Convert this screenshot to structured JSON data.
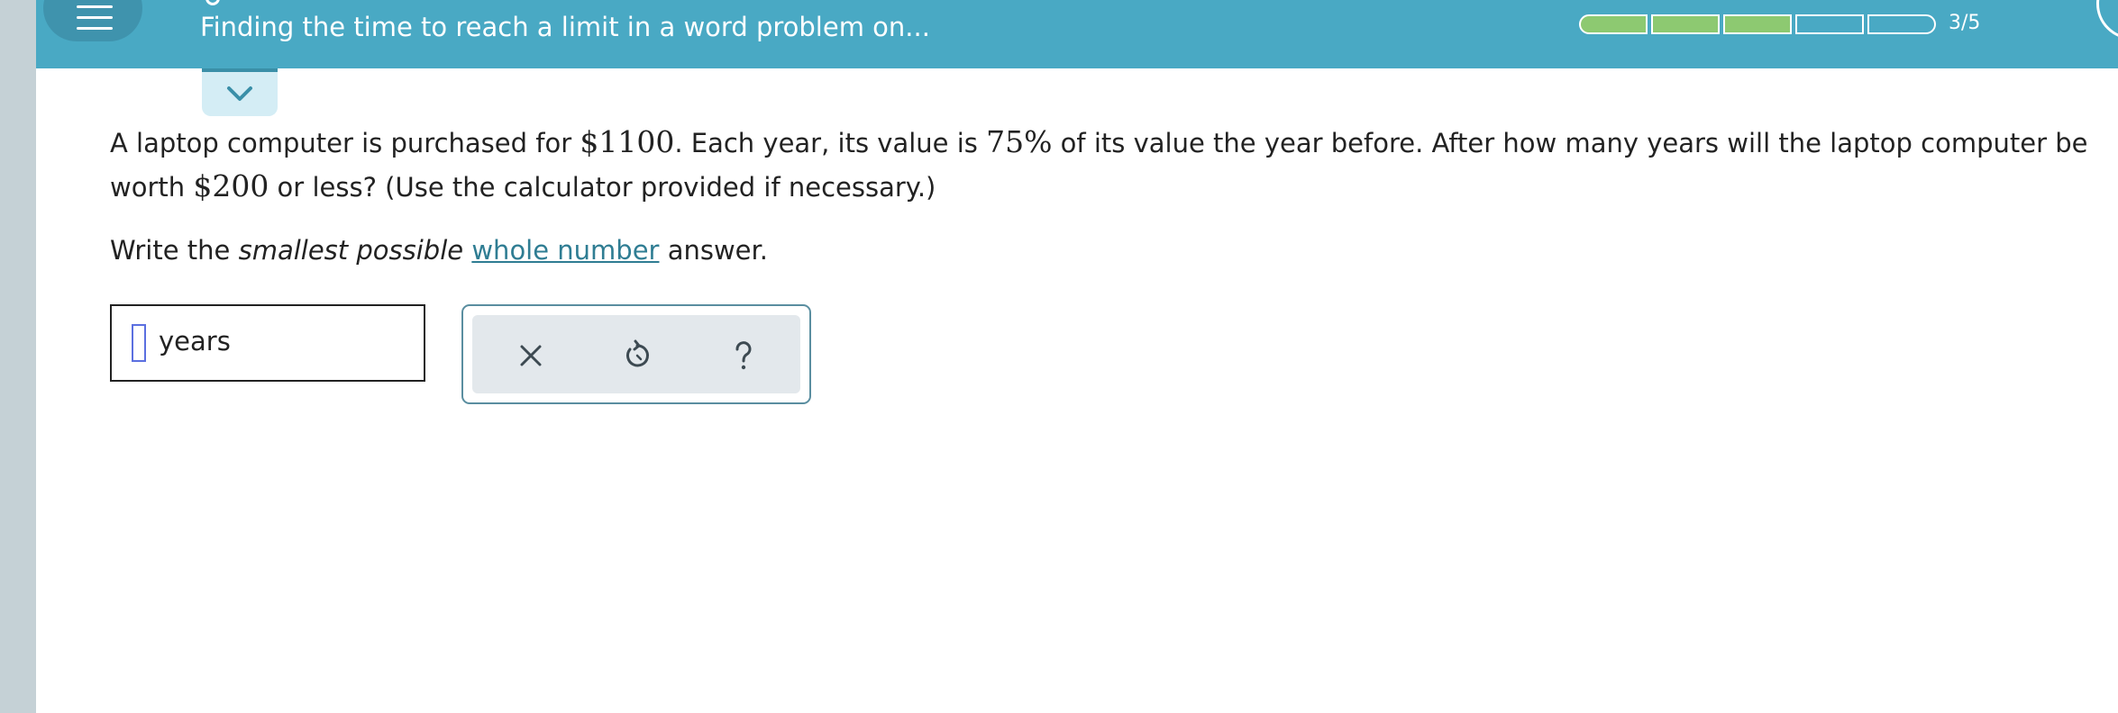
{
  "header": {
    "menu_icon": "hamburger-menu-icon",
    "topic_title": "Finding the time to reach a limit in a word problem on...",
    "progress": {
      "completed": 3,
      "total": 5,
      "label": "3/5"
    }
  },
  "problem": {
    "part1": "A laptop computer is purchased for ",
    "price": "$1100",
    "part2": ". Each year, its value is ",
    "percent": "75%",
    "part3": " of its value the year before. After how many years will the laptop computer be worth ",
    "target": "$200",
    "part4": " or less? (Use the calculator provided if necessary.)"
  },
  "instruction": {
    "before": "Write the ",
    "emphasis": "smallest possible",
    "space": " ",
    "link_text": "whole number",
    "after": " answer."
  },
  "answer": {
    "value": "",
    "unit": "years"
  },
  "tools": {
    "clear_icon": "close-icon",
    "undo_icon": "undo-icon",
    "help_icon": "question-mark-icon"
  },
  "colors": {
    "header_bg": "#49a9c4",
    "progress_done": "#8dc971",
    "link": "#2f7d93",
    "left_strip": "#c5d1d6"
  }
}
